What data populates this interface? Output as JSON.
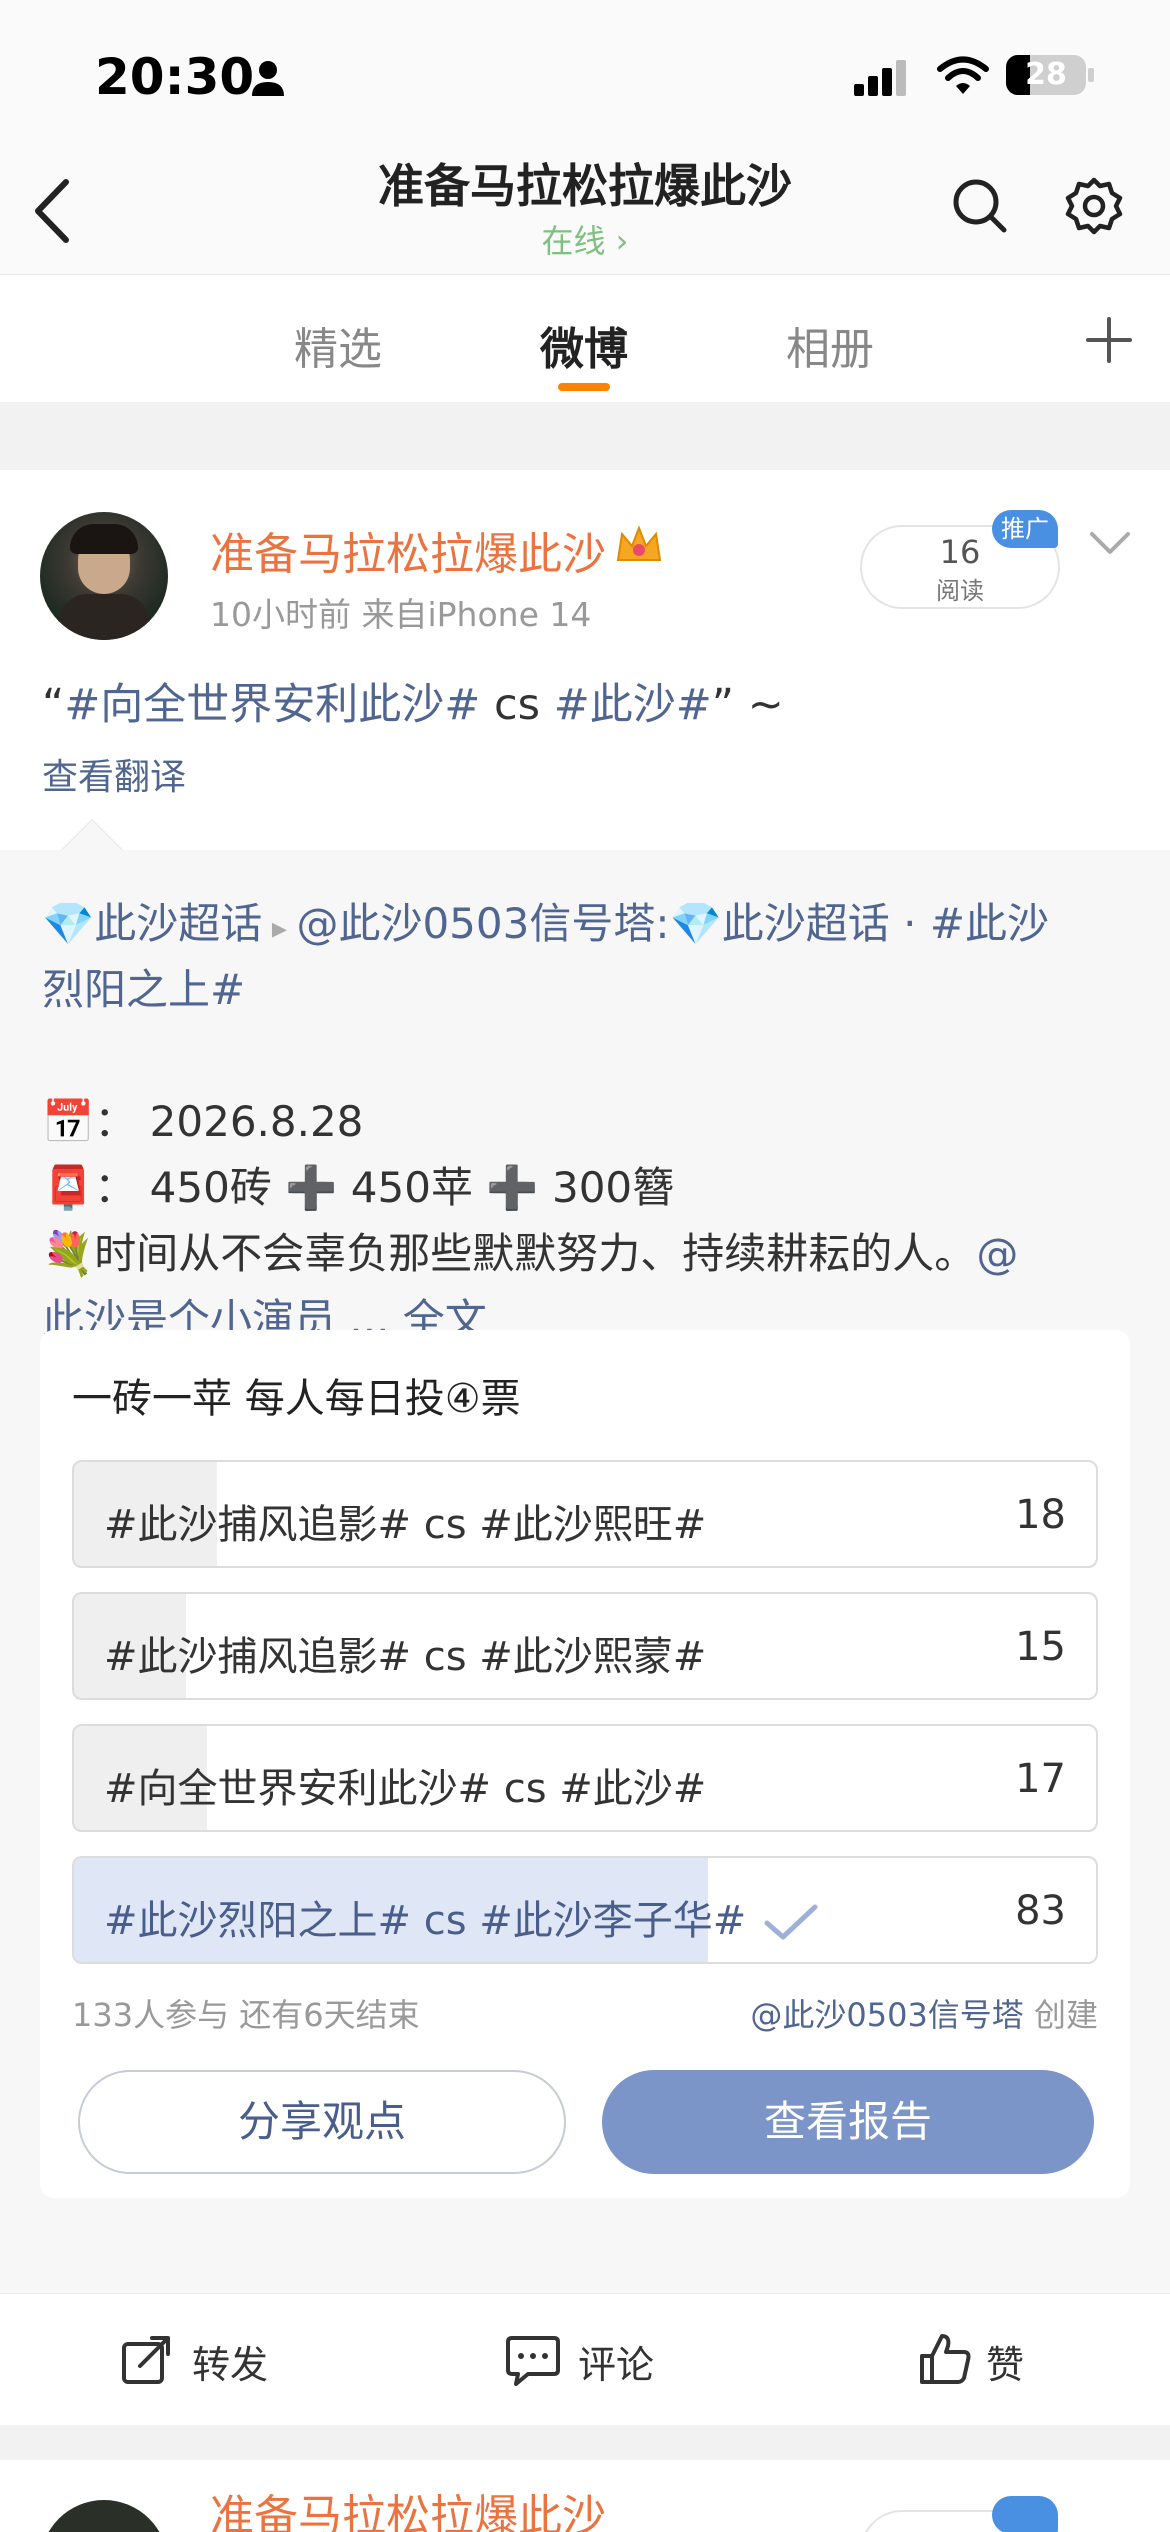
{
  "status": {
    "time": "20:30",
    "battery": "28"
  },
  "nav": {
    "title": "准备马拉松拉爆此沙",
    "subtitle": "在线 ›"
  },
  "tabs": [
    {
      "label": "精选"
    },
    {
      "label": "微博"
    },
    {
      "label": "相册"
    }
  ],
  "post": {
    "author": "准备马拉松拉爆此沙",
    "meta": "10小时前  来自iPhone 14",
    "reads_count": "16",
    "reads_label": "阅读",
    "promo_badge": "推广",
    "text_prefix": "“",
    "topic1": "#向全世界安利此沙#",
    "text_mid": " cs ",
    "topic2": "#此沙#",
    "text_suffix": "” ~",
    "translate": "查看翻译"
  },
  "retweet": {
    "line1_a": "💎此沙超话",
    "line1_b": " ▸ ",
    "line1_c": "@此沙0503信号塔",
    "line1_d": ":",
    "line1_e": "💎此沙超话",
    "line1_f": " · ",
    "line1_g": "#此沙",
    "line2": "烈阳之上#",
    "date_icon": "📅",
    "date_text": "：  2026.8.28",
    "mail_icon": "📮",
    "mail_text": "：  450砖 ➕ 450苹 ➕ 300簪",
    "flower_icon": "💐",
    "line_f": "时间从不会辜负那些默默努力、持续耕耘的人。",
    "line_f_at": "@",
    "line_g_at": "此沙是个小演员",
    "line_g_ellipsis": " ... ",
    "line_g_full": "全文"
  },
  "poll": {
    "title": "一砖一苹 每人每日投④票",
    "options": [
      {
        "label": "#此沙捕风追影# cs #此沙熙旺#",
        "count": "18",
        "share": 0.14
      },
      {
        "label": "#此沙捕风追影# cs #此沙熙蒙#",
        "count": "15",
        "share": 0.11
      },
      {
        "label": "#向全世界安利此沙# cs #此沙#",
        "count": "17",
        "share": 0.13
      },
      {
        "label": "#此沙烈阳之上# cs #此沙李子华#",
        "count": "83",
        "share": 0.62,
        "voted": true
      }
    ],
    "footer_left": "133人参与  还有6天结束",
    "footer_right_at": "@此沙0503信号塔",
    "footer_right_suffix": " 创建",
    "share_button": "分享观点",
    "report_button": "查看报告"
  },
  "actions": {
    "repost": "转发",
    "comment": "评论",
    "like": "赞"
  },
  "next_post": {
    "author": "准备马拉松拉爆此沙"
  },
  "colors": {
    "accent": "#ff8200",
    "author": "#eb7340",
    "link": "#506590",
    "report_button": "#7b95c8"
  }
}
